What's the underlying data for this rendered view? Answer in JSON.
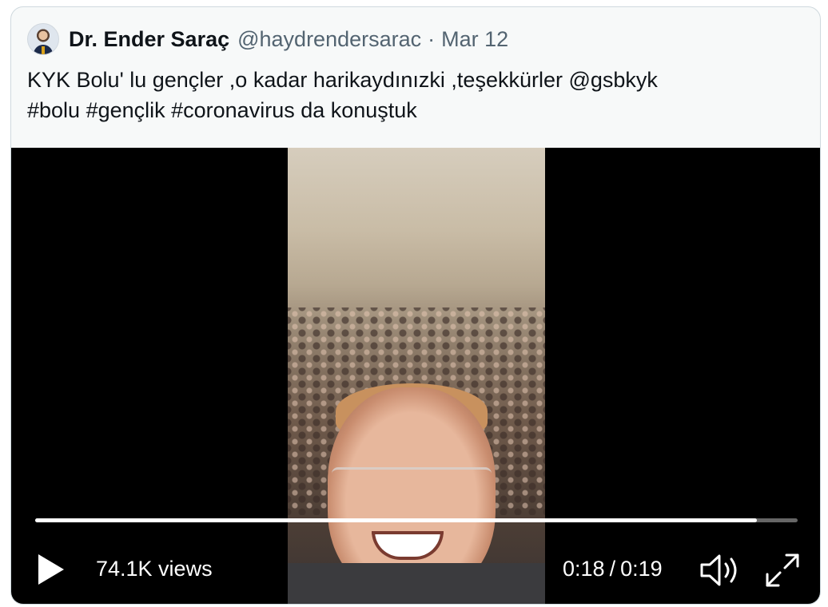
{
  "author": {
    "name": "Dr. Ender Saraç",
    "handle": "@haydrendersarac",
    "separator": "·",
    "date": "Mar 12",
    "avatar_icon": "profile-avatar"
  },
  "tweet": {
    "line1": "KYK Bolu' lu gençler ,o kadar harikaydınızki ,teşekkürler @gsbkyk",
    "line2": "#bolu #gençlik #coronavirus da konuştuk"
  },
  "video": {
    "views": "74.1K views",
    "current_time": "0:18",
    "time_separator": "/",
    "duration": "0:19",
    "progress_fraction": 0.947,
    "icons": {
      "play": "play-icon",
      "volume": "volume-icon",
      "fullscreen": "fullscreen-icon"
    }
  }
}
